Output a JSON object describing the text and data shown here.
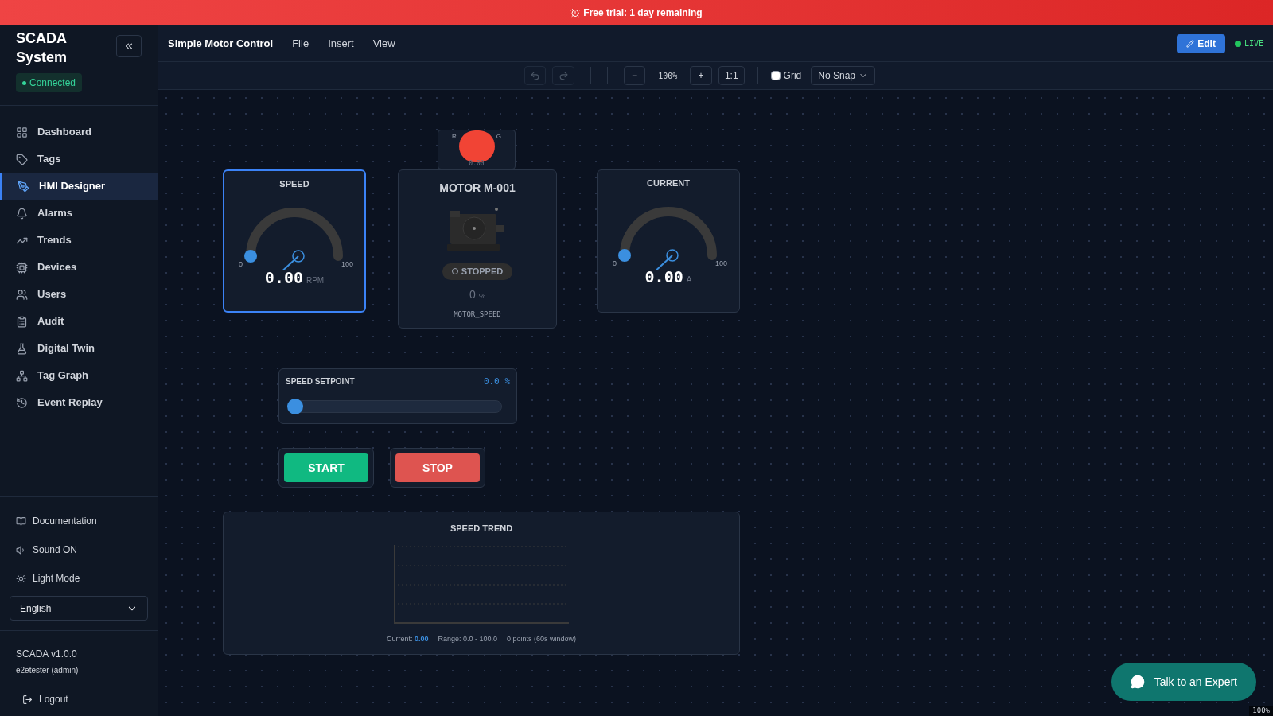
{
  "banner": {
    "text": "Free trial: 1 day remaining"
  },
  "sidebar": {
    "title": "SCADA System",
    "status": "Connected",
    "items": [
      {
        "label": "Dashboard",
        "selected": false
      },
      {
        "label": "Tags",
        "selected": false
      },
      {
        "label": "HMI Designer",
        "selected": true
      },
      {
        "label": "Alarms",
        "selected": false
      },
      {
        "label": "Trends",
        "selected": false
      },
      {
        "label": "Devices",
        "selected": false
      },
      {
        "label": "Users",
        "selected": false
      },
      {
        "label": "Audit",
        "selected": false
      },
      {
        "label": "Digital Twin",
        "selected": false
      },
      {
        "label": "Tag Graph",
        "selected": false
      },
      {
        "label": "Event Replay",
        "selected": false
      }
    ],
    "footer_links": [
      {
        "label": "Documentation"
      },
      {
        "label": "Sound ON"
      },
      {
        "label": "Light Mode"
      }
    ],
    "language": "English",
    "version": "SCADA v1.0.0",
    "user": "e2etester (admin)",
    "logout": "Logout"
  },
  "header": {
    "title": "Simple Motor Control",
    "menus": [
      "File",
      "Insert",
      "View"
    ],
    "edit_button": "Edit",
    "live": "LIVE"
  },
  "toolbar": {
    "zoom_out": "−",
    "zoom": "100%",
    "zoom_in": "+",
    "reset": "1:1",
    "grid": {
      "label": "Grid",
      "checked": false
    },
    "snap": "No Snap"
  },
  "canvas": {
    "indicator": {
      "label_start": "R",
      "label_end": "G",
      "value": "0.00",
      "on": true
    },
    "gauges": [
      {
        "title": "SPEED",
        "value": "0.00",
        "unit": "RPM",
        "min": "0",
        "max": "100",
        "level": 0,
        "selected": true
      },
      {
        "title": "CURRENT",
        "value": "0.00",
        "unit": "A",
        "min": "0",
        "max": "100",
        "level": 0,
        "selected": false
      }
    ],
    "motor": {
      "title": "MOTOR M-001",
      "status": "STOPPED",
      "running": false,
      "value": "0",
      "unit": "%",
      "tag": "MOTOR_SPEED"
    },
    "setpoint": {
      "title": "SPEED SETPOINT",
      "value": "0.0",
      "unit": "%",
      "level": 0
    },
    "buttons": [
      {
        "label": "START",
        "kind": "start"
      },
      {
        "label": "STOP",
        "kind": "stop"
      }
    ],
    "trend": {
      "title": "SPEED TREND",
      "current_label": "Current:",
      "current": "0.00",
      "range": "Range: 0.0 - 100.0",
      "points": "0 points (60s window)"
    },
    "zoom_badge": "100%"
  },
  "chat_button": "Talk to an Expert"
}
